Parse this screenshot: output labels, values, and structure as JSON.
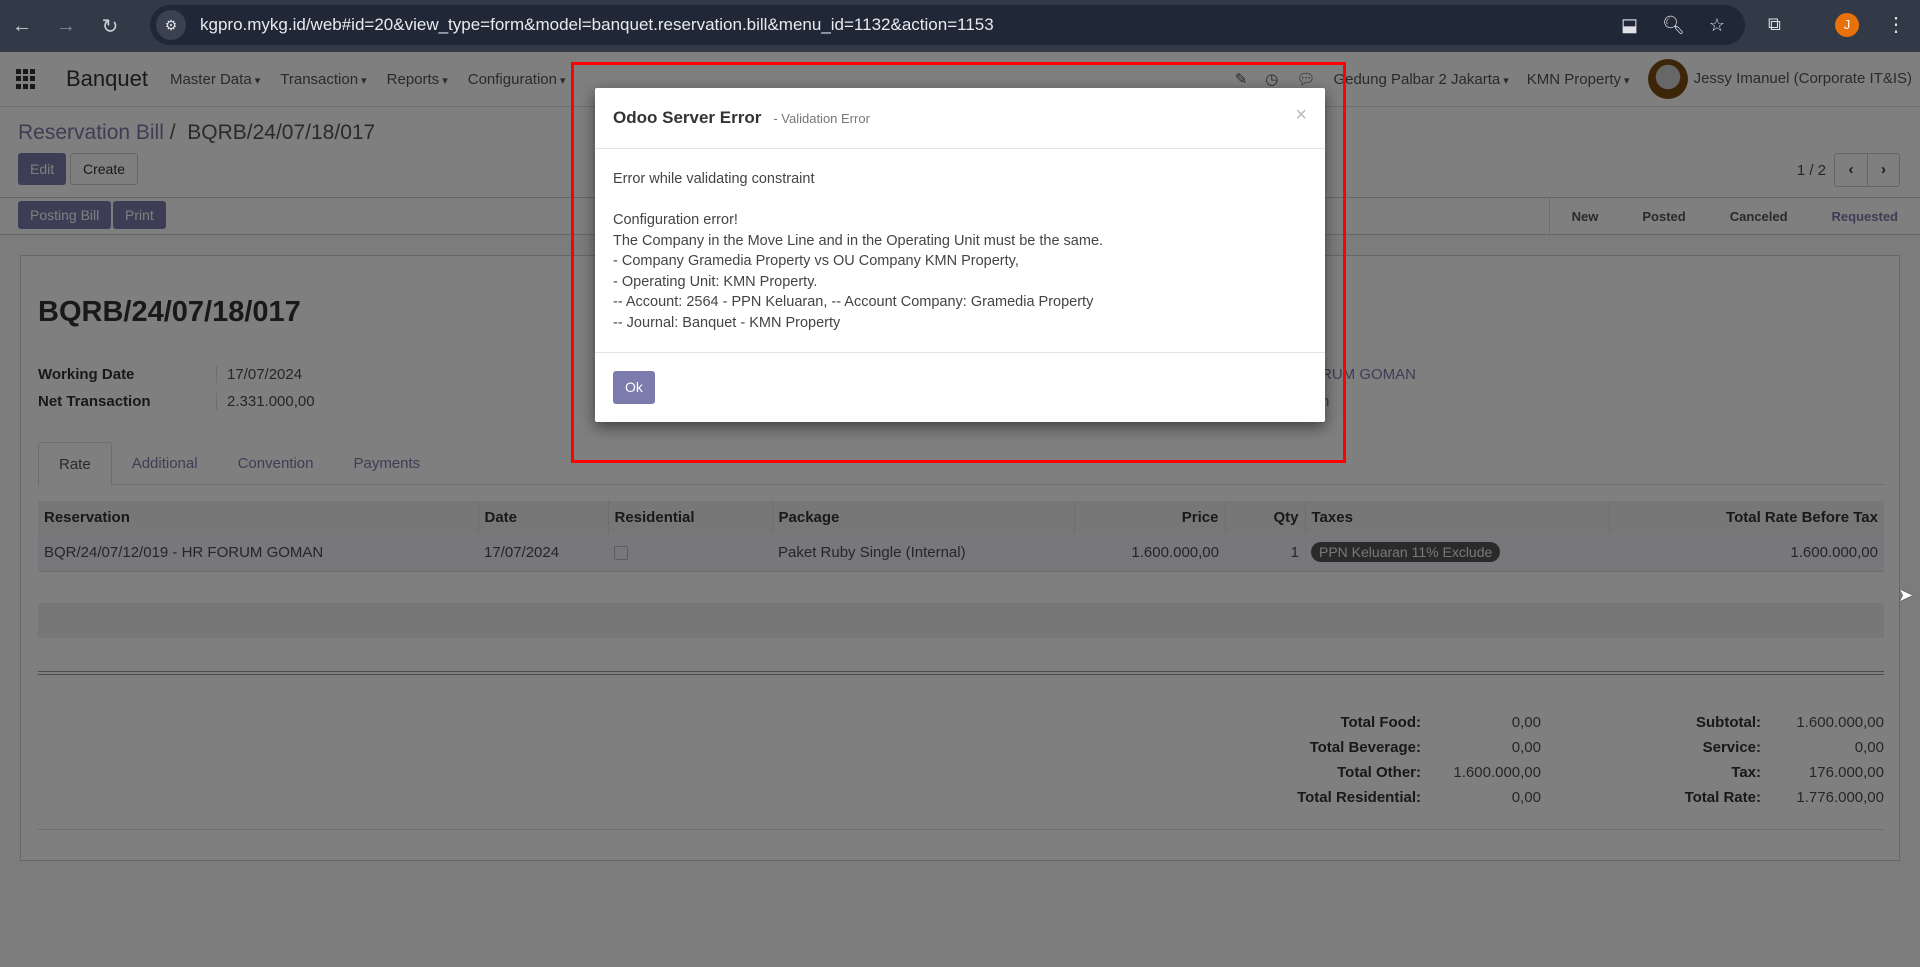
{
  "browser": {
    "url": "kgpro.mykg.id/web#id=20&view_type=form&model=banquet.reservation.bill&menu_id=1132&action=1153",
    "profile_initial": "J"
  },
  "navbar": {
    "app": "Banquet",
    "menus": [
      "Master Data",
      "Transaction",
      "Reports",
      "Configuration"
    ],
    "location": "Gedung Palbar 2 Jakarta",
    "company": "KMN Property",
    "user": "Jessy Imanuel (Corporate IT&IS)"
  },
  "control": {
    "breadcrumb_parent": "Reservation Bill",
    "breadcrumb_sep": "/",
    "breadcrumb_current": "BQRB/24/07/18/017",
    "edit": "Edit",
    "create": "Create",
    "pager": "1 / 2",
    "posting_bill": "Posting Bill",
    "print": "Print",
    "statuses": [
      "New",
      "Posted",
      "Canceled",
      "Requested"
    ]
  },
  "form": {
    "title": "BQRB/24/07/18/017",
    "fields": [
      {
        "label": "Working Date",
        "value": "17/07/2024"
      },
      {
        "label": "Net Transaction",
        "value": "2.331.000,00"
      }
    ],
    "partial_right": [
      "RUM GOMAN",
      "h"
    ],
    "tabs": [
      "Rate",
      "Additional",
      "Convention",
      "Payments"
    ],
    "table": {
      "headers": [
        "Reservation",
        "Date",
        "Residential",
        "Package",
        "Price",
        "Qty",
        "Taxes",
        "Total Rate Before Tax"
      ],
      "rows": [
        {
          "reservation": "BQR/24/07/12/019 - HR FORUM GOMAN",
          "date": "17/07/2024",
          "residential": false,
          "package": "Paket Ruby Single (Internal)",
          "price": "1.600.000,00",
          "qty": "1",
          "tax": "PPN Keluaran 11% Exclude",
          "total": "1.600.000,00"
        }
      ]
    },
    "totals_left": [
      {
        "label": "Total Food:",
        "value": "0,00"
      },
      {
        "label": "Total Beverage:",
        "value": "0,00"
      },
      {
        "label": "Total Other:",
        "value": "1.600.000,00"
      },
      {
        "label": "Total Residential:",
        "value": "0,00"
      }
    ],
    "totals_right": [
      {
        "label": "Subtotal:",
        "value": "1.600.000,00"
      },
      {
        "label": "Service:",
        "value": "0,00"
      },
      {
        "label": "Tax:",
        "value": "176.000,00"
      },
      {
        "label": "Total Rate:",
        "value": "1.776.000,00"
      }
    ]
  },
  "dialog": {
    "title": "Odoo Server Error",
    "subtitle": "- Validation Error",
    "close": "×",
    "lines": [
      "Error while validating constraint",
      "",
      "Configuration error!",
      "The Company in the Move Line and in the Operating Unit must be the same.",
      "- Company Gramedia Property vs OU Company KMN Property,",
      "- Operating Unit: KMN Property.",
      "-- Account: 2564 - PPN Keluaran, -- Account Company: Gramedia Property",
      "-- Journal: Banquet - KMN Property"
    ],
    "ok": "Ok"
  },
  "colors": {
    "brand": "#7c7bad",
    "highlight_box": "#ff0000"
  }
}
